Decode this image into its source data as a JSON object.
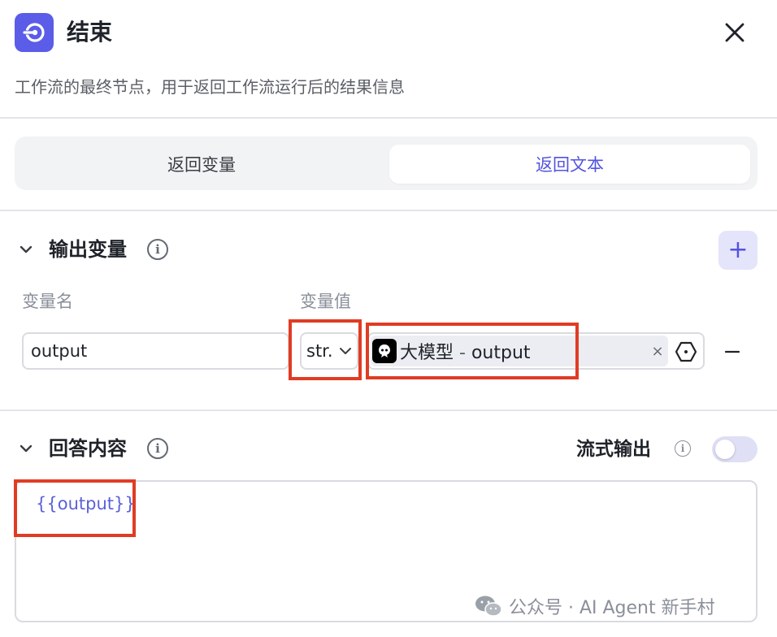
{
  "header": {
    "title": "结束",
    "node_icon": "end-node-icon",
    "close_icon": "close-icon",
    "description": "工作流的最终节点，用于返回工作流运行后的结果信息"
  },
  "tabs": [
    {
      "label": "返回变量",
      "active": false
    },
    {
      "label": "返回文本",
      "active": true
    }
  ],
  "output_section": {
    "title": "输出变量",
    "info_glyph": "i",
    "add_label": "+",
    "column_name_label": "变量名",
    "column_value_label": "变量值",
    "variable": {
      "name": "output",
      "type": "str.",
      "ref_source": "大模型",
      "ref_separator": " - ",
      "ref_field": "output",
      "clear_glyph": "×"
    }
  },
  "answer_section": {
    "title": "回答内容",
    "info_glyph": "i",
    "stream_label": "流式输出",
    "stream_enabled": false,
    "content": "{{output}}"
  },
  "watermark": {
    "text": "公众号 · AI Agent 新手村",
    "icon": "wechat-icon"
  },
  "colors": {
    "accent": "#5353e0",
    "highlight": "#e03c24",
    "node_icon_bg": "#5b5ce8"
  }
}
